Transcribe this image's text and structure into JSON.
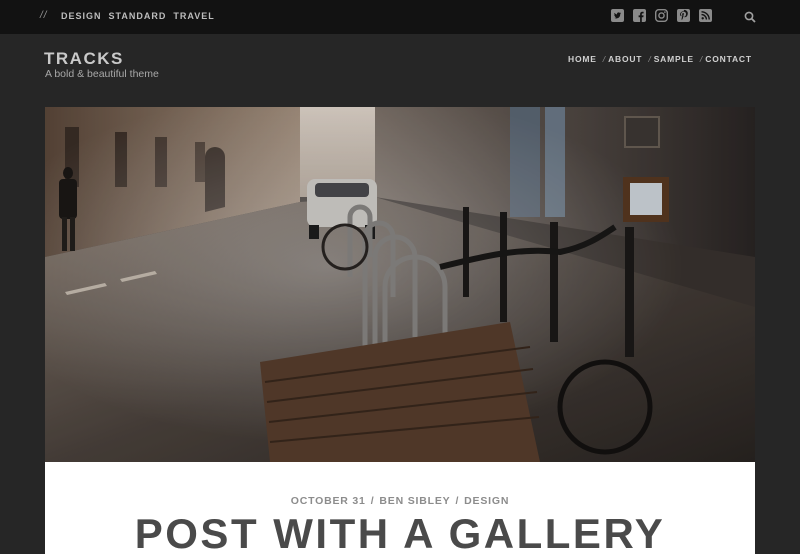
{
  "topbar": {
    "slashes": "//",
    "categories": [
      "DESIGN",
      "STANDARD",
      "TRAVEL"
    ]
  },
  "social": [
    "twitter-icon",
    "facebook-icon",
    "instagram-icon",
    "pinterest-icon",
    "rss-icon"
  ],
  "site": {
    "title": "TRACKS",
    "tagline": "A bold & beautiful theme"
  },
  "nav": {
    "items": [
      "HOME",
      "ABOUT",
      "SAMPLE",
      "CONTACT"
    ],
    "separator": "/"
  },
  "post": {
    "date": "OCTOBER 31",
    "author": "BEN SIBLEY",
    "category": "DESIGN",
    "separator": "/",
    "title": "POST WITH A GALLERY"
  },
  "colors": {
    "background": "#262626",
    "topbar": "#121212",
    "card": "#ffffff",
    "title_text": "#4a4a4a",
    "meta_text": "#8c8c8c"
  }
}
